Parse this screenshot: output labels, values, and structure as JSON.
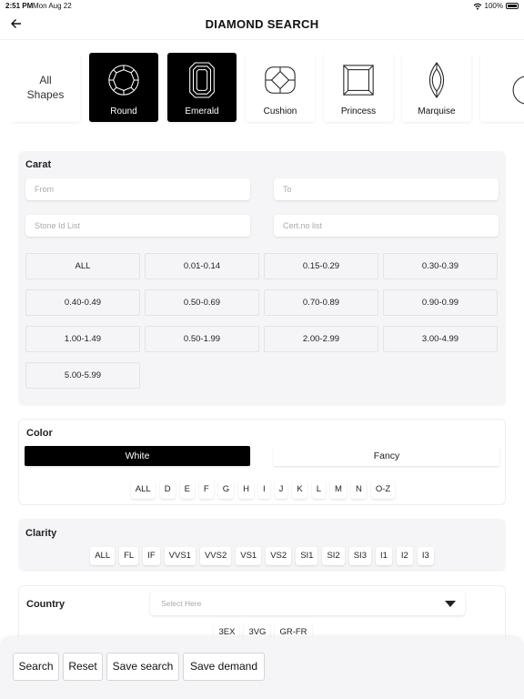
{
  "status_bar": {
    "time": "2:51 PM",
    "date": "Mon Aug 22",
    "battery": "100%",
    "icons": [
      "wifi-icon",
      "battery-icon"
    ]
  },
  "header": {
    "title": "DIAMOND SEARCH",
    "back_icon": "arrow-left-icon"
  },
  "shapes": {
    "all_label_line1": "All",
    "all_label_line2": "Shapes",
    "items": [
      {
        "label": "Round",
        "selected": true,
        "icon": "round-diamond-icon"
      },
      {
        "label": "Emerald",
        "selected": true,
        "icon": "emerald-diamond-icon"
      },
      {
        "label": "Cushion",
        "selected": false,
        "icon": "cushion-diamond-icon"
      },
      {
        "label": "Princess",
        "selected": false,
        "icon": "princess-diamond-icon"
      },
      {
        "label": "Marquise",
        "selected": false,
        "icon": "marquise-diamond-icon"
      }
    ]
  },
  "carat": {
    "title": "Carat",
    "from_placeholder": "From",
    "to_placeholder": "To",
    "stone_id_placeholder": "Stone Id List",
    "cert_placeholder": "Cert.no list",
    "ranges": [
      "ALL",
      "0.01-0.14",
      "0.15-0.29",
      "0.30-0.39",
      "0.40-0.49",
      "0.50-0.69",
      "0.70-0.89",
      "0.90-0.99",
      "1.00-1.49",
      "0.50-1.99",
      "2.00-2.99",
      "3.00-4.99",
      "5.00-5.99"
    ]
  },
  "color": {
    "title": "Color",
    "white_label": "White",
    "fancy_label": "Fancy",
    "active": "White",
    "grades": [
      "ALL",
      "D",
      "E",
      "F",
      "G",
      "H",
      "I",
      "J",
      "K",
      "L",
      "M",
      "N",
      "O-Z"
    ]
  },
  "clarity": {
    "title": "Clarity",
    "grades": [
      "ALL",
      "FL",
      "IF",
      "VVS1",
      "VVS2",
      "VS1",
      "VS2",
      "SI1",
      "SI2",
      "SI3",
      "I1",
      "I2",
      "I3"
    ]
  },
  "country": {
    "title": "Country",
    "placeholder": "Select Here",
    "chips": [
      "3EX",
      "3VG",
      "GR-FR"
    ]
  },
  "actions": {
    "search": "Search",
    "reset": "Reset",
    "save_search": "Save search",
    "save_demand": "Save demand"
  },
  "colors": {
    "accent": "#000000",
    "card_bg": "#f5f5f7",
    "page_bg": "#ffffff"
  }
}
